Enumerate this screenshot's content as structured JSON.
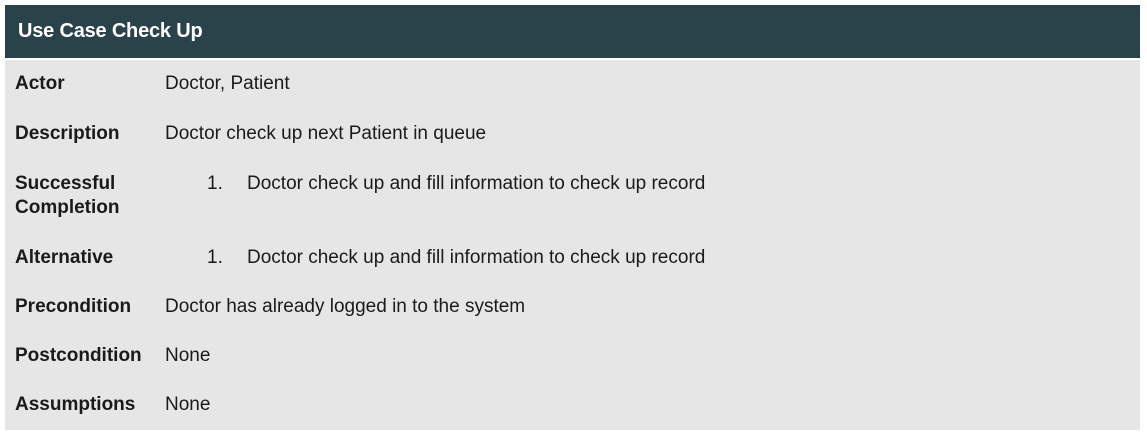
{
  "title": "Use Case Check Up",
  "rows": [
    {
      "label": "Actor",
      "value": "Doctor, Patient"
    },
    {
      "label": "Description",
      "value": "Doctor check up next Patient in queue"
    },
    {
      "label_line1": "Successful",
      "label_line2": "Completion",
      "num": "1.",
      "value": "Doctor check up and fill information to check up record"
    },
    {
      "label": "Alternative",
      "num": "1.",
      "value": "Doctor check up and fill information to check up record"
    },
    {
      "label": "Precondition",
      "value": "Doctor has already logged in to the system"
    },
    {
      "label": "Postcondition",
      "value": "None"
    },
    {
      "label": "Assumptions",
      "value": "None"
    }
  ],
  "colors": {
    "header_bg": "#2a424a",
    "body_bg": "#e6e6e6",
    "header_text": "#ffffff"
  }
}
